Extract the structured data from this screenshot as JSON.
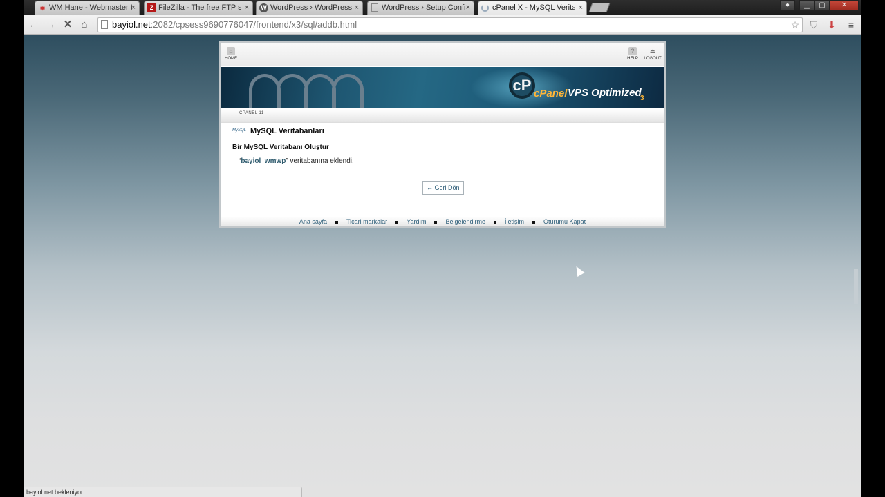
{
  "browser": {
    "tabs": [
      {
        "title": "WM Hane - Webmaster H",
        "favicon": "wm-icon"
      },
      {
        "title": "FileZilla - The free FTP solu",
        "favicon": "filezilla-icon"
      },
      {
        "title": "WordPress › WordPress Th",
        "favicon": "wordpress-icon"
      },
      {
        "title": "WordPress › Setup Config",
        "favicon": "page-icon"
      },
      {
        "title": "cPanel X - MySQL Veritab",
        "favicon": "loading-spinner-icon",
        "active": true
      }
    ],
    "tab_close": "×",
    "url_host": "bayiol.net",
    "url_rest": ":2082/cpsess9690776047/frontend/x3/sql/addb.html",
    "status_text": "bayiol.net bekleniyor..."
  },
  "cpanel": {
    "nav": {
      "home": "HOME",
      "help": "HELP",
      "logout": "LOGOUT"
    },
    "banner": {
      "logo_mark": "cP",
      "brand": "cPanel",
      "product": "VPS Optimized",
      "version": "3"
    },
    "breadcrumb": "CPANEL 11",
    "section_icon_text": "MySQL",
    "section_title": "MySQL Veritabanları",
    "subtitle": "Bir MySQL Veritabanı Oluştur",
    "message": {
      "quote_open": "“",
      "db_name": "bayiol_wmwp",
      "quote_close": "”",
      "text": " veritabanına eklendi."
    },
    "back_button": "← Geri Dön",
    "footer_links": [
      "Ana sayfa",
      "Ticari markalar",
      "Yardım",
      "Belgelendirme",
      "İletişim",
      "Oturumu Kapat"
    ]
  }
}
